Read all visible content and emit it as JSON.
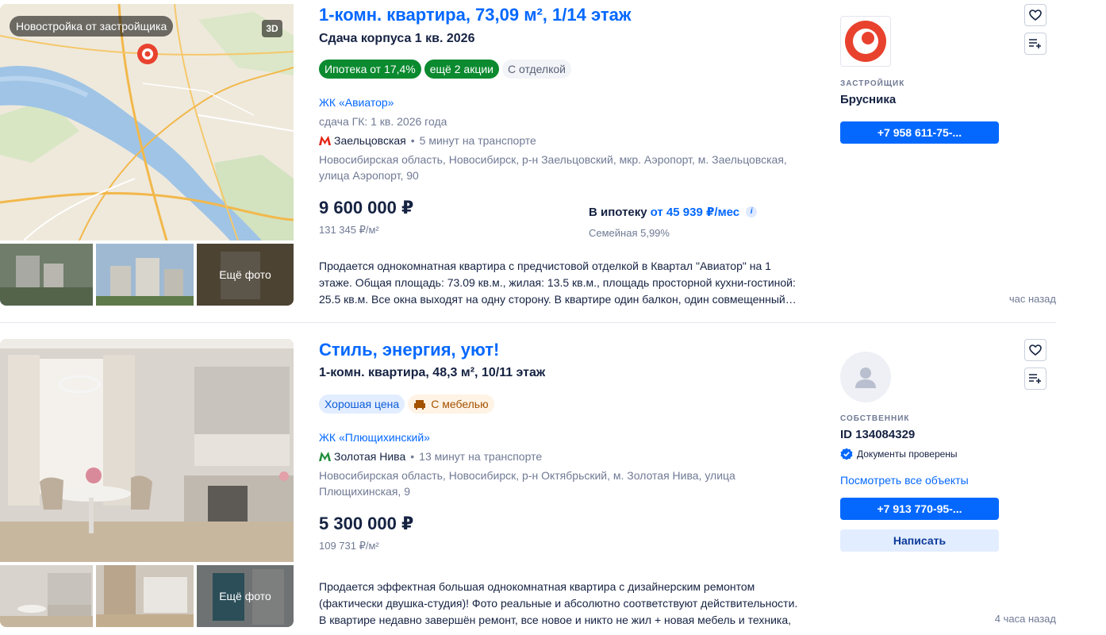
{
  "listings": [
    {
      "photo_badge": "Новостройка от застройщика",
      "photo_3d": "3D",
      "more_photo": "Ещё фото",
      "title": "1-комн. квартира, 73,09 м², 1/14 этаж",
      "subtitle": "Сдача корпуса 1 кв. 2026",
      "tags": [
        "Ипотека от 17,4%",
        "ещё 2 акции",
        "С отделкой"
      ],
      "complex": "ЖК «Авиатор»",
      "deadline": "сдача ГК: 1 кв. 2026 года",
      "metro": {
        "station": "Заельцовская",
        "travel": "5 минут на транспорте",
        "color": "#e42313"
      },
      "address": "Новосибирская область, Новосибирск, р-н Заельцовский, мкр. Аэропорт, м. Заельцовская, улица Аэропорт, 90",
      "price": "9 600 000 ₽",
      "price_per_m2": "131 345 ₽/м²",
      "mortgage_label": "В ипотеку",
      "mortgage_amount": "от 45 939 ₽/мес",
      "mortgage_rate": "Семейная 5,99%",
      "description": "Продается однокомнатная квартира с предчистовой отделкой в Квартал \"Авиатор\" на 1 этаже. Общая площадь: 73.09 кв.м., жилая: 13.5 кв.м., площадь просторной кухни-гостиной: 25.5 кв.м. Все окна выходят на одну сторону. В квартире один балкон, один совмещенный…",
      "time_ago": "час назад",
      "seller_role": "ЗАСТРОЙЩИК",
      "seller_name": "Брусника",
      "phone": "+7 958 611-75-..."
    },
    {
      "more_photo": "Ещё фото",
      "title": "Стиль, энергия, уют!",
      "subtitle": "1-комн. квартира, 48,3 м², 10/11 этаж",
      "tags": [
        "Хорошая цена",
        "С мебелью"
      ],
      "complex": "ЖК «Плющихинский»",
      "metro": {
        "station": "Золотая Нива",
        "travel": "13 минут на транспорте",
        "color": "#1f8f3a"
      },
      "address": "Новосибирская область, Новосибирск, р-н Октябрьский, м. Золотая Нива, улица Плющихинская, 9",
      "price": "5 300 000 ₽",
      "price_per_m2": "109 731 ₽/м²",
      "description": "Продается эффектная большая однокомнатная квартира с дизайнерским ремонтом (фактически двушка-студия)! Фото реальные и абсолютно соответствуют действительности. В квартире недавно завершён ремонт, все новое и никто не жил + новая мебель и техника, …",
      "time_ago": "4 часа назад",
      "seller_role": "СОБСТВЕННИК",
      "seller_name": "ID 134084329",
      "verified": "Документы проверены",
      "see_all": "Посмотреть все объекты",
      "phone": "+7 913 770-95-...",
      "write": "Написать"
    }
  ],
  "colors": {
    "accent": "#0468ff",
    "tag_green": "#0b8a2f",
    "text_primary": "#152242",
    "text_muted": "#707a95"
  },
  "icons": [
    "heart-icon",
    "add-to-list-icon",
    "metro-icon",
    "info-icon",
    "verified-icon",
    "sofa-icon",
    "person-icon",
    "brusnika-logo"
  ]
}
